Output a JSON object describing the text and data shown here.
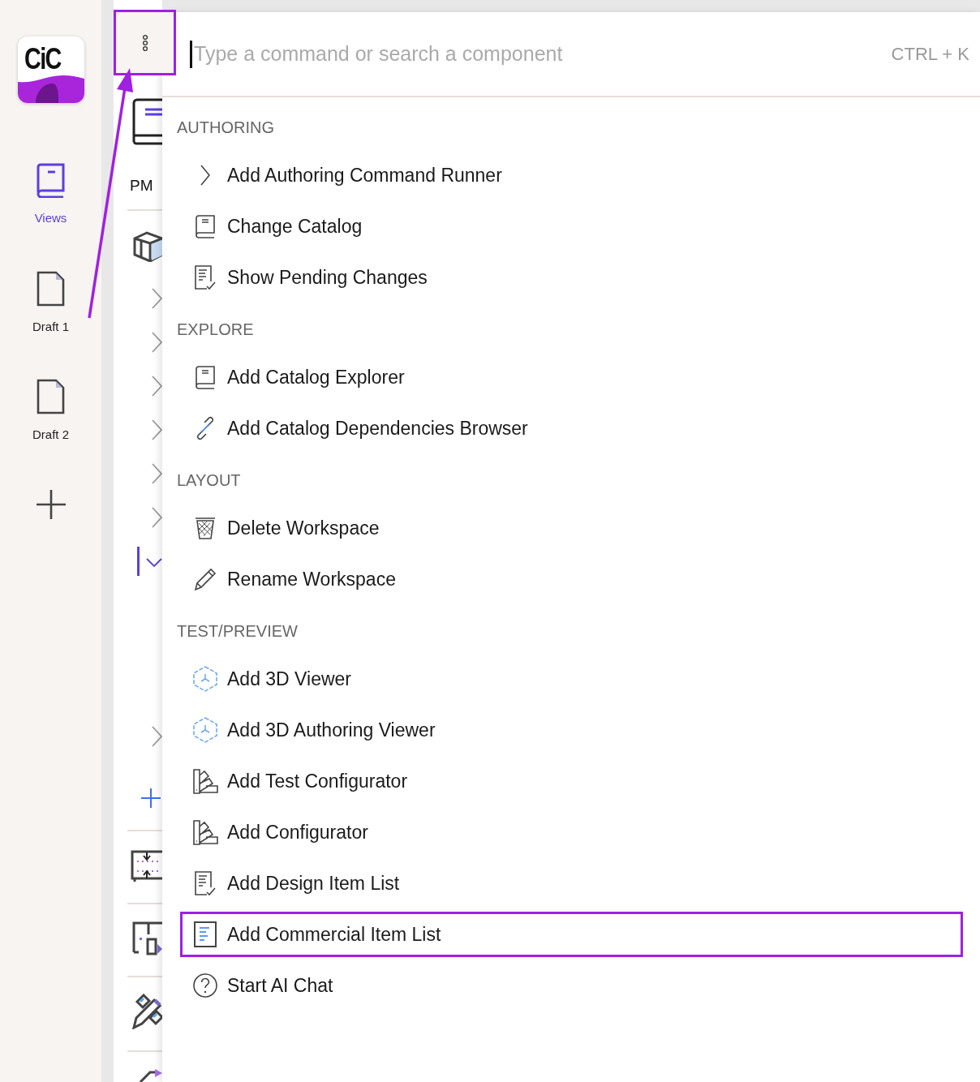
{
  "rail": {
    "logo_text": "CiC",
    "items": [
      {
        "label": "Views",
        "kind": "book",
        "selected": true
      },
      {
        "label": "Draft 1",
        "kind": "page",
        "selected": false
      },
      {
        "label": "Draft 2",
        "kind": "page",
        "selected": false
      }
    ]
  },
  "panel": {
    "menu_highlighted": true,
    "title": "PM",
    "tree": [
      {
        "expanded": false,
        "selected": false
      },
      {
        "expanded": false,
        "selected": false
      },
      {
        "expanded": false,
        "selected": false
      },
      {
        "expanded": false,
        "selected": false
      },
      {
        "expanded": false,
        "selected": false
      },
      {
        "expanded": false,
        "selected": false
      },
      {
        "expanded": true,
        "selected": true
      },
      {
        "expanded": false,
        "selected": false
      }
    ]
  },
  "palette": {
    "search": {
      "placeholder": "Type a command or search a component",
      "shortcut": "CTRL + K"
    },
    "groups": [
      {
        "title": "AUTHORING",
        "items": [
          {
            "label": "Add Authoring Command Runner",
            "kind": "chevron",
            "highlighted": false
          },
          {
            "label": "Change Catalog",
            "kind": "book",
            "highlighted": false
          },
          {
            "label": "Show Pending Changes",
            "kind": "checklist",
            "highlighted": false
          }
        ]
      },
      {
        "title": "EXPLORE",
        "items": [
          {
            "label": "Add Catalog Explorer",
            "kind": "book",
            "highlighted": false
          },
          {
            "label": "Add Catalog Dependencies Browser",
            "kind": "link",
            "highlighted": false
          }
        ]
      },
      {
        "title": "LAYOUT",
        "items": [
          {
            "label": "Delete Workspace",
            "kind": "trash",
            "highlighted": false
          },
          {
            "label": "Rename Workspace",
            "kind": "pencil",
            "highlighted": false
          }
        ]
      },
      {
        "title": "TEST/PREVIEW",
        "items": [
          {
            "label": "Add 3D Viewer",
            "kind": "cube",
            "highlighted": false
          },
          {
            "label": "Add 3D Authoring Viewer",
            "kind": "cube",
            "highlighted": false
          },
          {
            "label": "Add Test Configurator",
            "kind": "swatch",
            "highlighted": false
          },
          {
            "label": "Add Configurator",
            "kind": "swatch",
            "highlighted": false
          },
          {
            "label": "Add Design Item List",
            "kind": "checklist",
            "highlighted": false
          },
          {
            "label": "Add Commercial Item List",
            "kind": "list",
            "highlighted": true
          },
          {
            "label": "Start AI Chat",
            "kind": "help",
            "highlighted": false
          }
        ]
      }
    ]
  }
}
